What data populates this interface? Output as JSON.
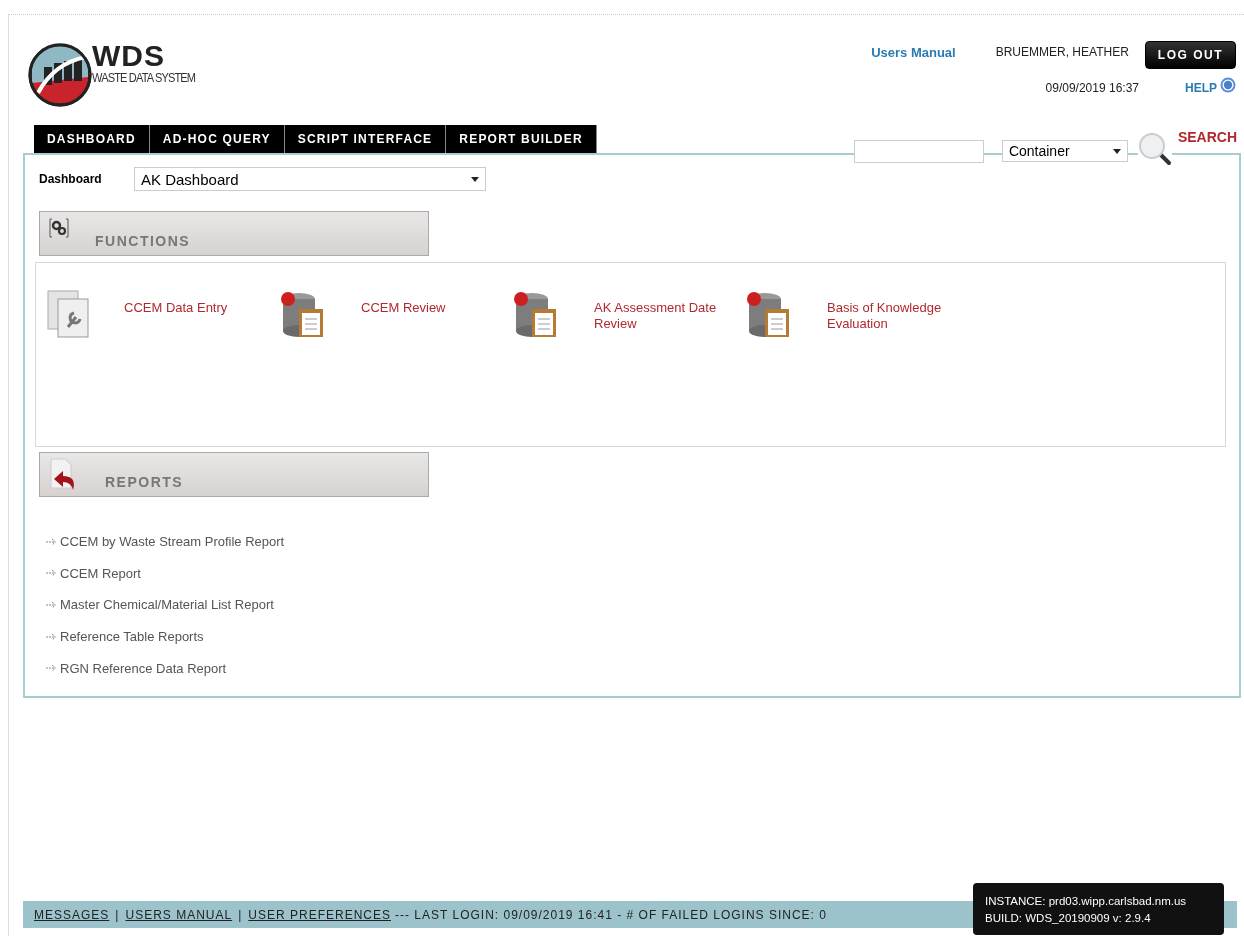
{
  "header": {
    "logo_title": "WDS",
    "logo_subtitle": "WASTE DATA SYSTEM",
    "users_manual_link": "Users Manual",
    "user_name": "BRUEMMER, HEATHER",
    "logout_button": "LOG OUT",
    "datetime": "09/09/2019 16:37",
    "help_link": "HELP"
  },
  "tabs": [
    {
      "label": "DASHBOARD"
    },
    {
      "label": "AD-HOC QUERY"
    },
    {
      "label": "SCRIPT INTERFACE"
    },
    {
      "label": "REPORT BUILDER"
    }
  ],
  "search": {
    "type_select": "Container",
    "button": "SEARCH"
  },
  "dashboard": {
    "label": "Dashboard",
    "select": "AK Dashboard"
  },
  "functions": {
    "title": "FUNCTIONS",
    "items": [
      {
        "label": "CCEM Data Entry",
        "kind": "form"
      },
      {
        "label": "CCEM Review",
        "kind": "database"
      },
      {
        "label": "AK Assessment Date Review",
        "kind": "database"
      },
      {
        "label": "Basis of Knowledge Evaluation",
        "kind": "database"
      }
    ]
  },
  "reports": {
    "title": "REPORTS",
    "items": [
      "CCEM by Waste Stream Profile Report",
      "CCEM Report",
      "Master Chemical/Material List Report",
      "Reference Table Reports",
      "RGN Reference Data Report"
    ]
  },
  "footer": {
    "links": [
      "MESSAGES",
      "USERS MANUAL",
      "USER PREFERENCES"
    ],
    "separator": "|",
    "info": "--- LAST LOGIN: 09/09/2019 16:41 - # OF FAILED LOGINS SINCE: 0"
  },
  "instance_tooltip": {
    "instance": "INSTANCE: prd03.wipp.carlsbad.nm.us",
    "build": "BUILD: WDS_20190909 v: 2.9.4"
  }
}
